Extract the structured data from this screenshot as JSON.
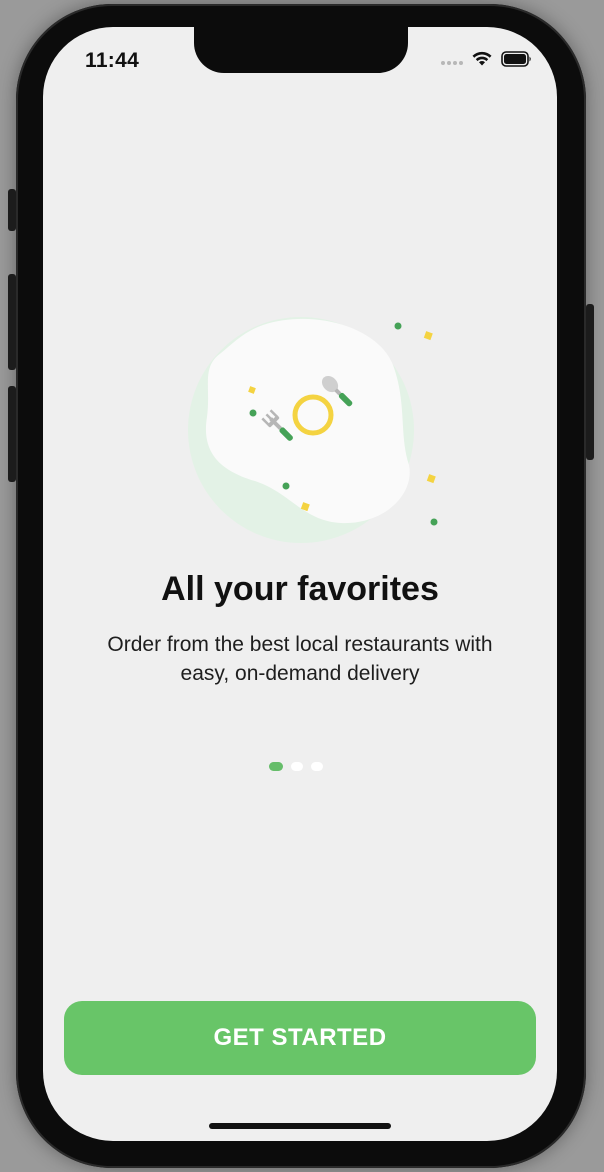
{
  "status_bar": {
    "time": "11:44",
    "icons": [
      "signal-dots-icon",
      "wifi-icon",
      "battery-icon"
    ]
  },
  "onboarding": {
    "title": "All your favorites",
    "description": "Order from the best local restaurants with easy, on-demand delivery",
    "illustration": "plate-fork-spoon-icon",
    "page_indicator": {
      "total": 3,
      "active_index": 0
    }
  },
  "cta": {
    "label": "GET STARTED"
  },
  "colors": {
    "accent_green": "#68c568",
    "illustration_yellow": "#f4d341",
    "screen_background": "#efefef",
    "blob_light_green": "#e3f2e6"
  }
}
